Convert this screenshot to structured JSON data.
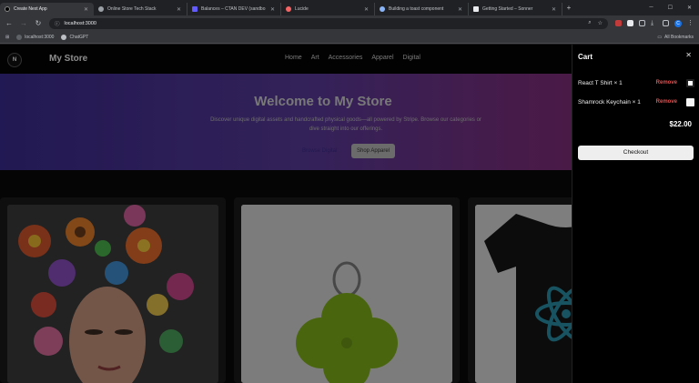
{
  "browser": {
    "tabs": [
      {
        "title": "Create Next App",
        "active": true,
        "color": "#e8eaed"
      },
      {
        "title": "Online Store Tech Stack",
        "active": false,
        "color": "#9aa0a6"
      },
      {
        "title": "Balances – CTAN DEV (sandbo",
        "active": false,
        "color": "#635bff"
      },
      {
        "title": "Lucide",
        "active": false,
        "color": "#f56565"
      },
      {
        "title": "Building a toast component",
        "active": false,
        "color": "#8ab4f8"
      },
      {
        "title": "Getting Started – Sonner",
        "active": false,
        "color": "#e8eaed"
      }
    ],
    "address": "localhost:3000",
    "profile_initial": "C",
    "bookmarks": [
      {
        "label": "localhost:3000"
      },
      {
        "label": "ChatGPT"
      }
    ],
    "all_bookmarks_label": "All Bookmarks"
  },
  "store": {
    "brand": "My Store",
    "logo_letter": "N",
    "nav_links": [
      "Home",
      "Art",
      "Accessories",
      "Apparel",
      "Digital"
    ],
    "hero": {
      "title": "Welcome to My Store",
      "subtitle": "Discover unique digital assets and handcrafted physical goods—all powered by Stripe. Browse our categories or dive straight into our offerings.",
      "primary_button": "Browse Digital",
      "secondary_button": "Shop Apparel"
    }
  },
  "cart": {
    "title": "Cart",
    "items": [
      {
        "label": "React T Shirt × 1",
        "remove": "Remove"
      },
      {
        "label": "Shamrock Keychain × 1",
        "remove": "Remove"
      }
    ],
    "total": "$22.00",
    "checkout_label": "Checkout"
  },
  "colors": {
    "accent_remove": "#e05050",
    "hero_gradient_start": "#3a2b8f",
    "hero_gradient_end": "#8a2a6a"
  }
}
